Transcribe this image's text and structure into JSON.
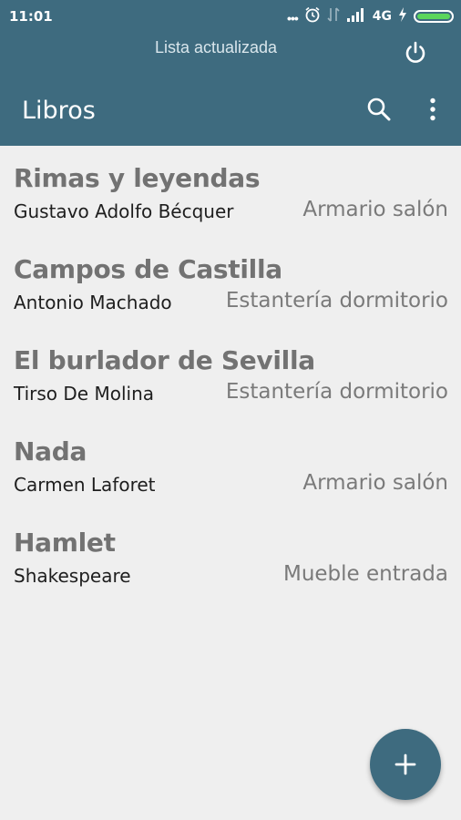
{
  "status_bar": {
    "time": "11:01",
    "network": "4G",
    "icons": [
      "more-dots-icon",
      "alarm-icon",
      "data-icon",
      "signal-icon",
      "charging-icon",
      "battery-icon"
    ]
  },
  "header": {
    "notice": "Lista actualizada",
    "title": "Libros",
    "color": "#3e6b7f"
  },
  "books": [
    {
      "title": "Rimas y leyendas",
      "author": "Gustavo Adolfo Bécquer",
      "location": "Armario salón"
    },
    {
      "title": "Campos de Castilla",
      "author": "Antonio Machado",
      "location": "Estantería dormitorio"
    },
    {
      "title": "El burlador de Sevilla",
      "author": "Tirso De Molina",
      "location": "Estantería dormitorio"
    },
    {
      "title": "Nada",
      "author": "Carmen Laforet",
      "location": "Armario salón"
    },
    {
      "title": "Hamlet",
      "author": "Shakespeare",
      "location": "Mueble entrada"
    }
  ],
  "fab": {
    "icon": "plus-icon"
  }
}
